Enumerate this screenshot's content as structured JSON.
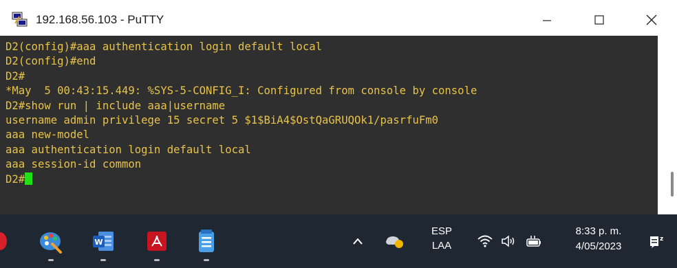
{
  "window": {
    "title": "192.168.56.103 - PuTTY"
  },
  "terminal": {
    "lines": [
      "D2(config)#aaa authentication login default local",
      "D2(config)#end",
      "D2#",
      "*May  5 00:43:15.449: %SYS-5-CONFIG_I: Configured from console by console",
      "D2#show run | include aaa|username",
      "username admin privilege 15 secret 5 $1$BiA4$OstQaGRUQOk1/pasrfuFm0",
      "aaa new-model",
      "aaa authentication login default local",
      "aaa session-id common"
    ],
    "prompt": "D2#",
    "text_color": "#e8c34a",
    "background": "#2f2f2f",
    "cursor_color": "#22e018"
  },
  "taskbar": {
    "apps": [
      {
        "name": "paint-icon"
      },
      {
        "name": "word-icon"
      },
      {
        "name": "acrobat-icon"
      },
      {
        "name": "notepad-icon"
      }
    ],
    "tray": {
      "lang_line1": "ESP",
      "lang_line2": "LAA",
      "time": "8:33 p. m.",
      "date": "4/05/2023"
    }
  }
}
